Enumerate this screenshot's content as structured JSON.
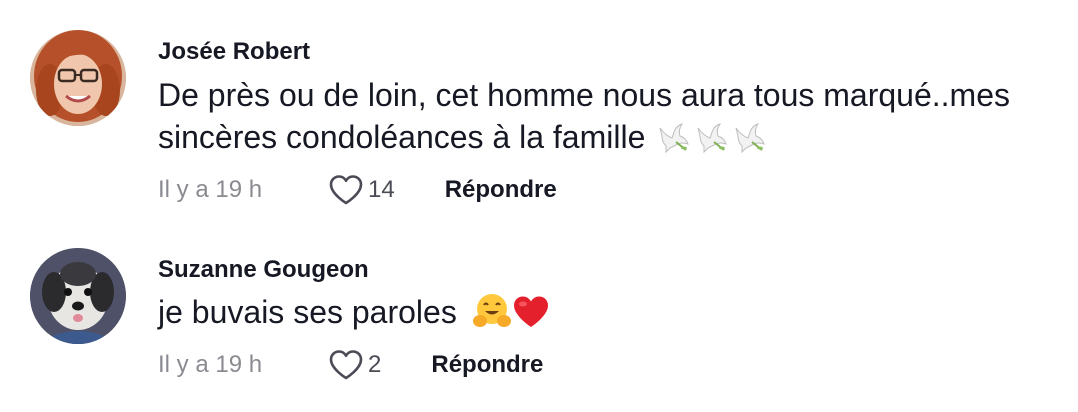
{
  "comments": [
    {
      "author": "Josée Robert",
      "text_line1": "De près ou de loin, cet homme nous aura tous marqué..mes",
      "text_line2": "sincères condoléances à la famille",
      "emojis": [
        "dove-icon",
        "dove-icon",
        "dove-icon"
      ],
      "time": "Il y a 19 h",
      "likes": "14",
      "reply_label": "Répondre"
    },
    {
      "author": "Suzanne Gougeon",
      "text": "je buvais ses paroles",
      "emojis": [
        "hugging-face-icon",
        "red-heart-icon"
      ],
      "time": "Il y a 19 h",
      "likes": "2",
      "reply_label": "Répondre"
    }
  ],
  "colors": {
    "text": "#161823",
    "secondary": "#8a8b91",
    "heart": "#e4202c"
  }
}
